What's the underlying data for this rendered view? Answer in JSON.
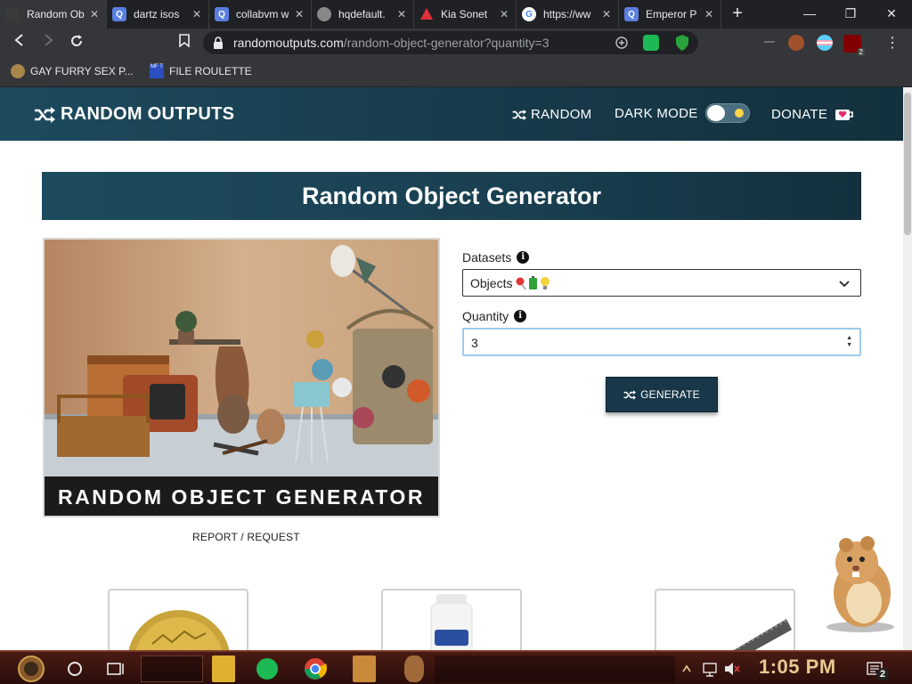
{
  "browser": {
    "tabs": [
      {
        "title": "Random Ob",
        "favicon": "random-outputs-icon",
        "active": true
      },
      {
        "title": "dartz isos",
        "favicon": "q-icon",
        "active": false
      },
      {
        "title": "collabvm w",
        "favicon": "q-icon",
        "active": false
      },
      {
        "title": "hqdefault.",
        "favicon": "globe-icon",
        "active": false
      },
      {
        "title": "Kia Sonet",
        "favicon": "kia-icon",
        "active": false
      },
      {
        "title": "https://ww",
        "favicon": "google-icon",
        "active": false
      },
      {
        "title": "Emperor P",
        "favicon": "q-icon",
        "active": false
      }
    ],
    "new_tab_label": "+",
    "address": {
      "domain": "randomoutputs.com",
      "path": "/random-object-generator?quantity=3"
    },
    "bookmarks": [
      {
        "label": "GAY FURRY SEX P..."
      },
      {
        "label": "FILE ROULETTE",
        "icon_text": "MF\nT"
      }
    ],
    "extension_badge": "2"
  },
  "site": {
    "brand": "RANDOM OUTPUTS",
    "nav": {
      "random": "RANDOM",
      "dark_mode": "DARK MODE",
      "donate": "DONATE"
    },
    "dark_mode_on": false
  },
  "main": {
    "page_title": "Random Object Generator",
    "hero_caption": "RANDOM OBJECT GENERATOR",
    "report_link": "REPORT / REQUEST",
    "datasets_label": "Datasets",
    "datasets_value": "Objects",
    "quantity_label": "Quantity",
    "quantity_value": "3",
    "generate_label": "GENERATE"
  },
  "taskbar": {
    "clock": "1:05 PM",
    "notification_count": "2"
  },
  "colors": {
    "header": "#1d4a5e",
    "button": "#183849",
    "input_focus": "#9ecaf0"
  }
}
